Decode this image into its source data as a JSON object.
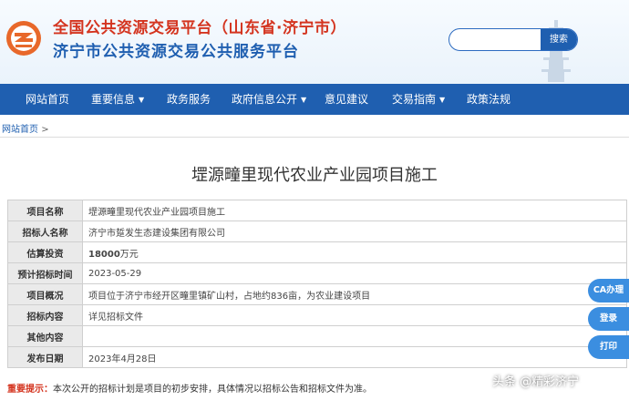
{
  "header": {
    "title_line1": "全国公共资源交易平台（山东省·济宁市）",
    "title_line2": "济宁市公共资源交易公共服务平台",
    "search_placeholder": "",
    "search_button": "搜索"
  },
  "nav": {
    "items": [
      {
        "label": "网站首页",
        "dropdown": false
      },
      {
        "label": "重要信息",
        "dropdown": true
      },
      {
        "label": "政务服务",
        "dropdown": false
      },
      {
        "label": "政府信息公开",
        "dropdown": true
      },
      {
        "label": "意见建议",
        "dropdown": false
      },
      {
        "label": "交易指南",
        "dropdown": true
      },
      {
        "label": "政策法规",
        "dropdown": false
      }
    ],
    "caret": "▼"
  },
  "breadcrumb": {
    "home": "网站首页",
    "separator": ">"
  },
  "page": {
    "title": "堽源疃里现代农业产业园项目施工"
  },
  "table": {
    "rows": [
      {
        "label": "项目名称",
        "value": "堽源疃里现代农业产业园项目施工"
      },
      {
        "label": "招标人名称",
        "value": "济宁市踅发生态建设集团有限公司"
      },
      {
        "label": "估算投资",
        "value_strong": "18000",
        "value_suffix": "万元"
      },
      {
        "label": "预计招标时间",
        "value": "2023-05-29"
      },
      {
        "label": "项目概况",
        "value": "项目位于济宁市经开区疃里镇矿山村，占地约836亩，为农业建设项目"
      },
      {
        "label": "招标内容",
        "value": "详见招标文件"
      },
      {
        "label": "其他内容",
        "value": ""
      },
      {
        "label": "发布日期",
        "value": "2023年4月28日"
      }
    ]
  },
  "notice": {
    "label": "重要提示：",
    "text": "本次公开的招标计划是项目的初步安排，具体情况以招标公告和招标文件为准。"
  },
  "side_buttons": [
    "CA办理",
    "登录",
    "打印"
  ],
  "watermark": "头条 @精彩济宁",
  "colors": {
    "brand_blue": "#1f5fb0",
    "brand_red": "#d4341f",
    "side_blue": "#3b8ee0",
    "label_bg": "#eaeaea"
  }
}
